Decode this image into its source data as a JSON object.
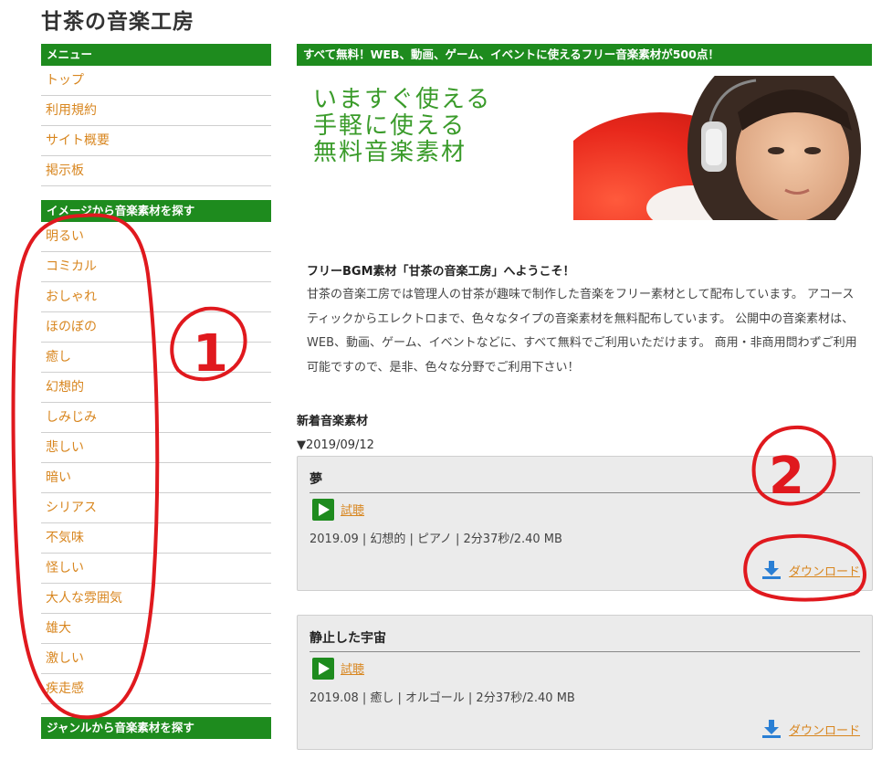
{
  "site": {
    "title": "甘茶の音楽工房"
  },
  "sidebar": {
    "menu_heading": "メニュー",
    "menu_items": [
      {
        "label": "トップ"
      },
      {
        "label": "利用規約"
      },
      {
        "label": "サイト概要"
      },
      {
        "label": "掲示板"
      }
    ],
    "image_heading": "イメージから音楽素材を探す",
    "image_items": [
      {
        "label": "明るい"
      },
      {
        "label": "コミカル"
      },
      {
        "label": "おしゃれ"
      },
      {
        "label": "ほのぼの"
      },
      {
        "label": "癒し"
      },
      {
        "label": "幻想的"
      },
      {
        "label": "しみじみ"
      },
      {
        "label": "悲しい"
      },
      {
        "label": "暗い"
      },
      {
        "label": "シリアス"
      },
      {
        "label": "不気味"
      },
      {
        "label": "怪しい"
      },
      {
        "label": "大人な雰囲気"
      },
      {
        "label": "雄大"
      },
      {
        "label": "激しい"
      },
      {
        "label": "疾走感"
      }
    ],
    "genre_heading": "ジャンルから音楽素材を探す"
  },
  "main": {
    "heading": "すべて無料！WEB、動画、ゲーム、イベントに使えるフリー音楽素材が500点！",
    "hero": {
      "line1": "いますぐ使える",
      "line2": "手軽に使える",
      "line3": "無料音楽素材"
    },
    "welcome_title": "フリーBGM素材「甘茶の音楽工房」へようこそ！",
    "welcome_body": "甘茶の音楽工房では管理人の甘茶が趣味で制作した音楽をフリー素材として配布しています。 アコースティックからエレクトロまで、色々なタイプの音楽素材を無料配布しています。 公開中の音楽素材は、WEB、動画、ゲーム、イベントなどに、すべて無料でご利用いただけます。 商用・非商用問わずご利用可能ですので、是非、色々な分野でご利用下さい！",
    "new_heading": "新着音楽素材",
    "date_line": "▼2019/09/12",
    "tracks": [
      {
        "title": "夢",
        "listen": "試聴",
        "meta": "2019.09 | 幻想的 | ピアノ | 2分37秒/2.40 MB",
        "download": "ダウンロード"
      },
      {
        "title": "静止した宇宙",
        "listen": "試聴",
        "meta": "2019.08 | 癒し | オルゴール | 2分37秒/2.40 MB",
        "download": "ダウンロード"
      }
    ]
  },
  "annotations": {
    "mark1": "1",
    "mark2": "2",
    "color": "#e0191e"
  },
  "colors": {
    "accent_green": "#1e8b1e",
    "link_orange": "#d8861f",
    "hero_green": "#3a9b2a"
  }
}
